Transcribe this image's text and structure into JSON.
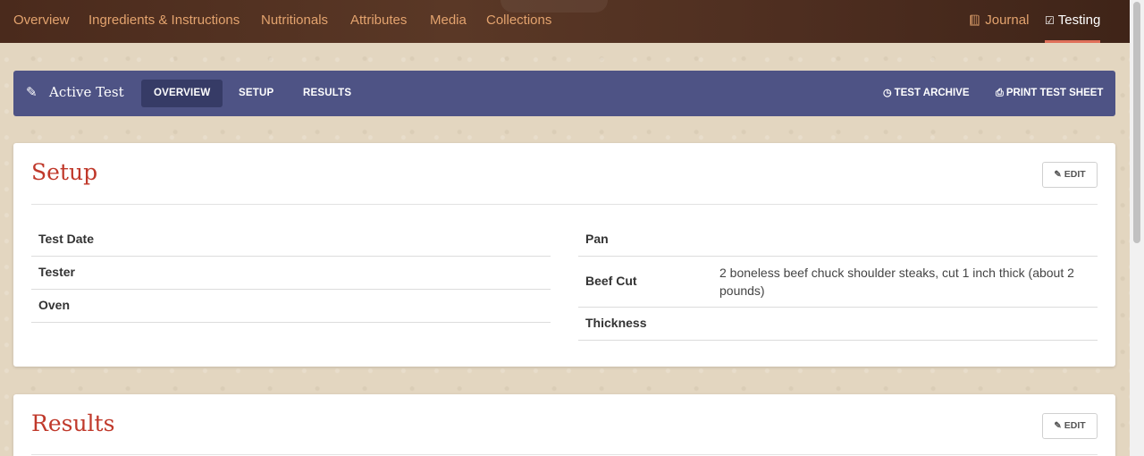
{
  "topnav": {
    "items": [
      "Overview",
      "Ingredients & Instructions",
      "Nutritionals",
      "Attributes",
      "Media",
      "Collections"
    ],
    "journal": "Journal",
    "testing": "Testing"
  },
  "testbar": {
    "title": "Active Test",
    "tabs": [
      "OVERVIEW",
      "SETUP",
      "RESULTS"
    ],
    "archive": "TEST ARCHIVE",
    "print": "PRINT TEST SHEET"
  },
  "setup": {
    "title": "Setup",
    "edit": "EDIT",
    "left": [
      {
        "label": "Test Date",
        "value": ""
      },
      {
        "label": "Tester",
        "value": ""
      },
      {
        "label": "Oven",
        "value": ""
      }
    ],
    "right": [
      {
        "label": "Pan",
        "value": ""
      },
      {
        "label": "Beef Cut",
        "value": "2 boneless beef chuck shoulder steaks, cut 1 inch thick (about 2 pounds)"
      },
      {
        "label": "Thickness",
        "value": ""
      }
    ]
  },
  "results": {
    "title": "Results",
    "edit": "EDIT"
  },
  "icons": {
    "journal": "book-icon",
    "testing": "checkbox-icon",
    "active_test": "pencil-icon",
    "archive": "clock-icon",
    "print": "print-icon",
    "edit": "pencil-icon"
  },
  "colors": {
    "nav_bg": "#4a2a1c",
    "nav_link": "#e3a36e",
    "nav_active_underline": "#e0705a",
    "testbar_bg": "#4e5385",
    "testbar_active_tab": "#363b66",
    "heading": "#c0392b"
  }
}
